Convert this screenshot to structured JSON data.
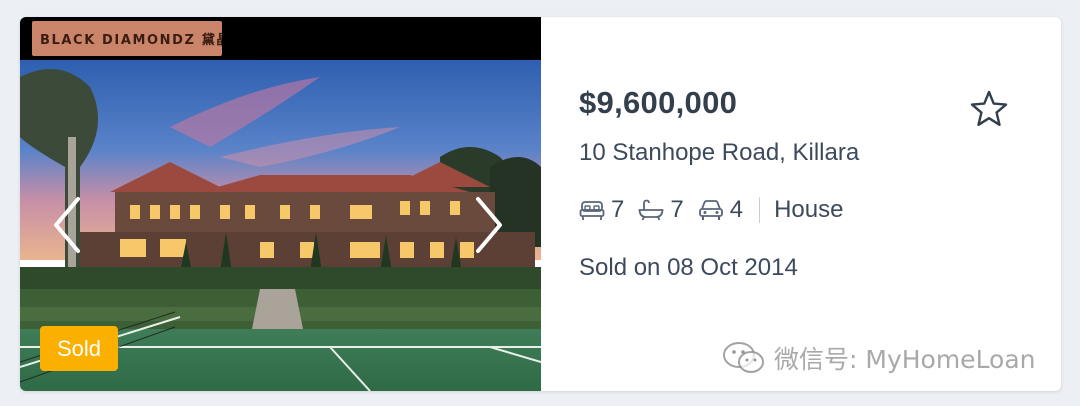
{
  "brand": {
    "logo_text": "BLACK DIAMONDZ 黛晶"
  },
  "listing": {
    "status_badge": "Sold",
    "price": "$9,600,000",
    "address": "10 Stanhope Road, Killara",
    "bedrooms": "7",
    "bathrooms": "7",
    "parking": "4",
    "property_type": "House",
    "sold_text": "Sold on 08 Oct 2014"
  },
  "icons": {
    "prev": "chevron-left-icon",
    "next": "chevron-right-icon",
    "favourite": "star-outline-icon",
    "bed": "bed-icon",
    "bath": "bath-icon",
    "car": "car-icon",
    "wechat": "wechat-icon"
  },
  "watermark": {
    "text": "微信号: MyHomeLoan"
  },
  "colors": {
    "badge": "#fbb000",
    "text": "#3d4a5c",
    "background": "#eceff3"
  }
}
